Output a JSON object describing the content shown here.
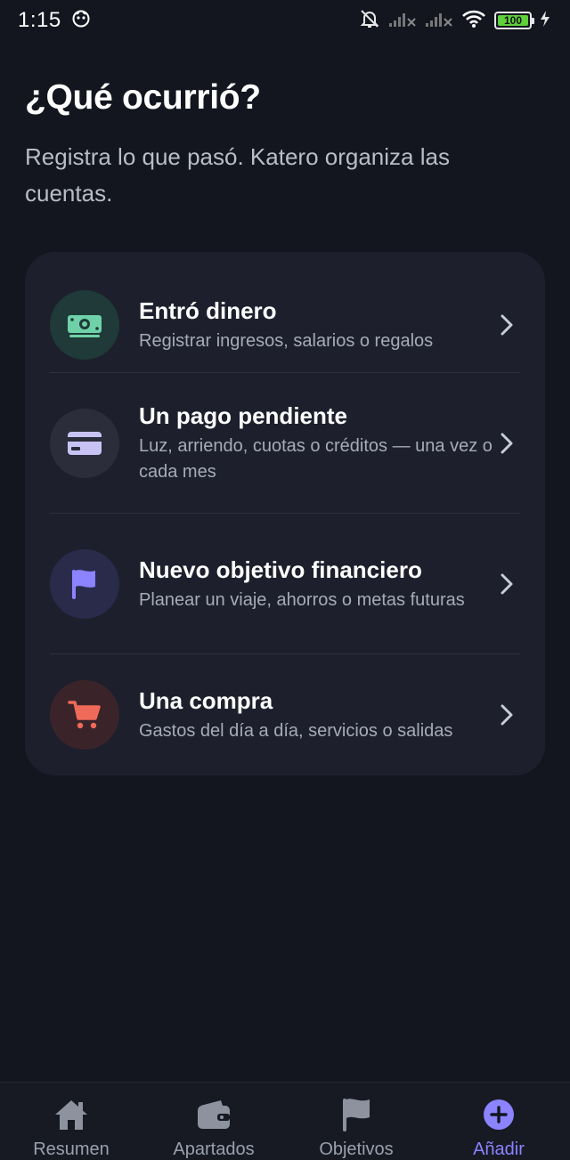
{
  "status_bar": {
    "time": "1:15",
    "battery": "100"
  },
  "header": {
    "title": "¿Qué ocurrió?",
    "subtitle": "Registra lo que pasó. Katero organiza las cuentas."
  },
  "options": [
    {
      "title": "Entró dinero",
      "description": "Registrar ingresos, salarios o regalos",
      "icon": "money-icon",
      "color": "#6fd1a8"
    },
    {
      "title": "Un pago pendiente",
      "description": "Luz, arriendo, cuotas o créditos — una vez o cada mes",
      "icon": "credit-card-icon",
      "color": "#c9c3f5"
    },
    {
      "title": "Nuevo objetivo financiero",
      "description": "Planear un viaje, ahorros o metas futuras",
      "icon": "flag-icon",
      "color": "#8b83ff"
    },
    {
      "title": "Una compra",
      "description": "Gastos del día a día, servicios o salidas",
      "icon": "shopping-cart-icon",
      "color": "#f06a5a"
    }
  ],
  "bottom_nav": [
    {
      "label": "Resumen",
      "icon": "home-icon",
      "active": false
    },
    {
      "label": "Apartados",
      "icon": "wallet-icon",
      "active": false
    },
    {
      "label": "Objetivos",
      "icon": "flag-icon",
      "active": false
    },
    {
      "label": "Añadir",
      "icon": "add-circle-icon",
      "active": true
    }
  ],
  "colors": {
    "background": "#13161f",
    "card": "#1d202c",
    "accent": "#8b83ff"
  }
}
